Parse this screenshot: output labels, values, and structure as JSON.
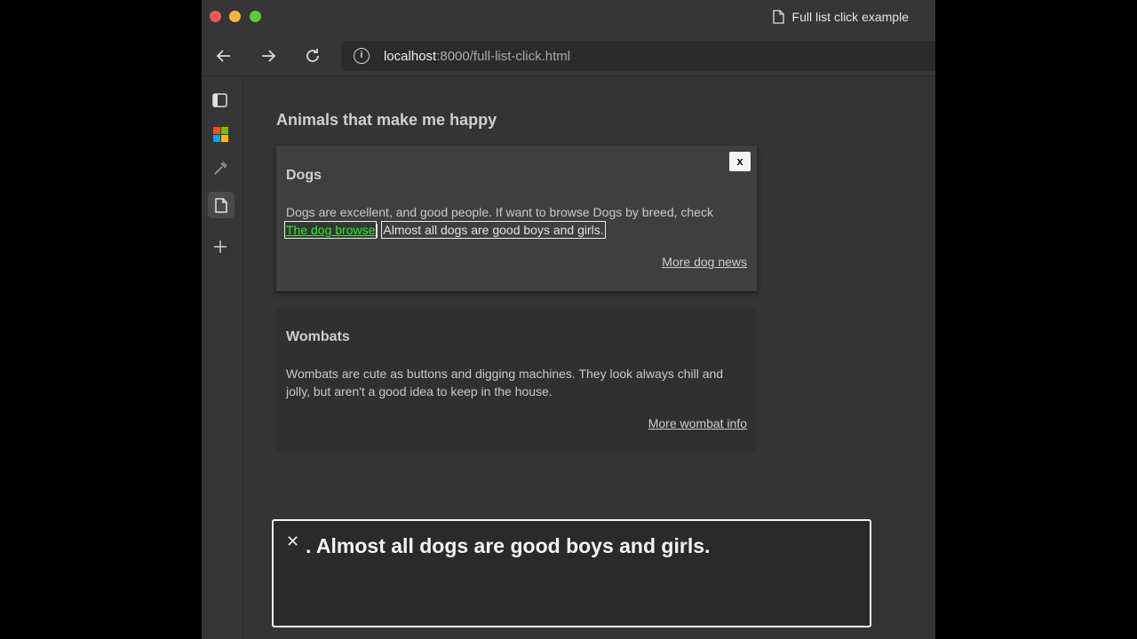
{
  "window": {
    "tab_title": "Full list click example"
  },
  "toolbar": {
    "url_host": "localhost",
    "url_rest": ":8000/full-list-click.html"
  },
  "page": {
    "heading": "Animals that make me happy"
  },
  "dogs_card": {
    "title": "Dogs",
    "body": "Dogs are excellent, and good people. If want to browse Dogs by breed, check",
    "highlighted_link": "The dog browse",
    "highlighted_text": "Almost all dogs are good boys and girls.",
    "close_label": "x",
    "link": "More dog news"
  },
  "wombats_card": {
    "title": "Wombats",
    "body": "Wombats are cute as buttons and digging machines. They look always chill and jolly, but aren't a good idea to keep in the house.",
    "link": "More wombat info"
  },
  "caption": {
    "close_label": "✕",
    "text": ". Almost all dogs are good boys and girls."
  },
  "colors": {
    "link_highlight": "#3be23b",
    "close_red": "#ed5a55",
    "minimize_yellow": "#f2b73a",
    "maximize_green": "#5fc83c"
  },
  "icons": {
    "sidebar": [
      "sidebar-toggle-icon",
      "microsoft-logo-icon",
      "tools-icon",
      "page-icon",
      "plus-icon"
    ]
  }
}
